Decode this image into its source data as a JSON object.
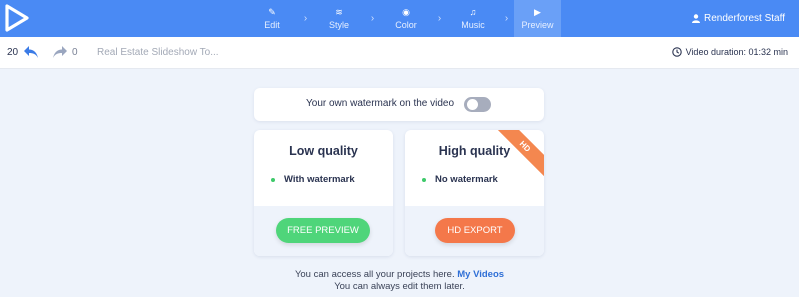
{
  "nav": {
    "steps": [
      {
        "label": "Edit",
        "icon": "pencil-icon",
        "glyph": "✎"
      },
      {
        "label": "Style",
        "icon": "layers-icon",
        "glyph": "≋"
      },
      {
        "label": "Color",
        "icon": "palette-icon",
        "glyph": "◉"
      },
      {
        "label": "Music",
        "icon": "music-icon",
        "glyph": "♫"
      },
      {
        "label": "Preview",
        "icon": "play-icon",
        "glyph": "▶"
      }
    ],
    "active_step": "Preview",
    "separator": "›",
    "user_name": "Renderforest Staff"
  },
  "toolbar": {
    "undo_count": "20",
    "redo_count": "0",
    "project_name": "Real Estate Slideshow To...",
    "video_duration": "Video duration: 01:32 min"
  },
  "watermark": {
    "label": "Your own watermark on the video",
    "enabled": false
  },
  "plans": {
    "low": {
      "title": "Low quality",
      "feature": "With watermark",
      "button": "FREE PREVIEW"
    },
    "high": {
      "title": "High quality",
      "feature": "No watermark",
      "button": "HD EXPORT",
      "ribbon": "HD"
    }
  },
  "footer": {
    "line1_text": "You can access all your projects here.",
    "line1_link": "My Videos",
    "line2": "You can always edit them later."
  },
  "colors": {
    "nav_bg": "#4a8af4",
    "active_step_bg": "#6aa0f7",
    "free_button": "#4fd57a",
    "hd_button": "#f4784a",
    "ribbon": "#f4874f",
    "link": "#2f6fd6"
  }
}
